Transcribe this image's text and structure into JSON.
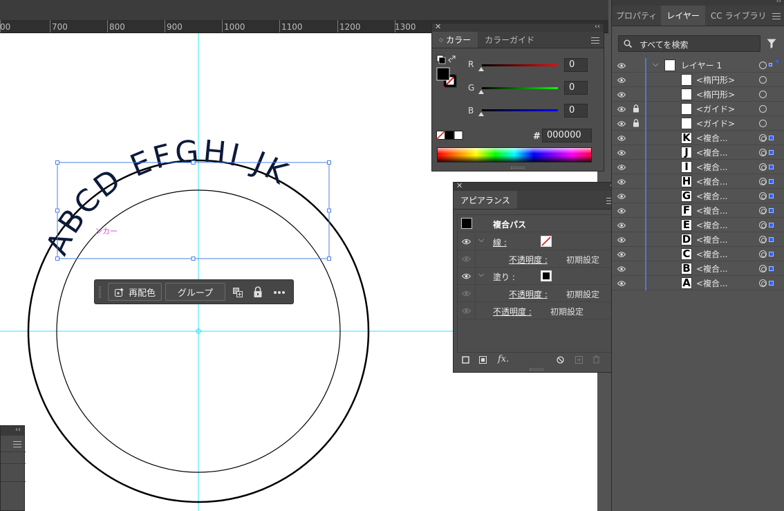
{
  "ruler": {
    "labels": [
      "00",
      "700",
      "800",
      "900",
      "1000",
      "1100",
      "1200",
      "1300"
    ]
  },
  "canvas": {
    "curved_text": "ABCD EFGHI JK",
    "anchor_label": "ンカー"
  },
  "context_toolbar": {
    "recolor_label": "再配色",
    "group_label": "グループ"
  },
  "color_panel": {
    "tabs": [
      "カラー",
      "カラーガイド"
    ],
    "r_label": "R",
    "g_label": "G",
    "b_label": "B",
    "r_value": "0",
    "g_value": "0",
    "b_value": "0",
    "hex_label": "#",
    "hex_value": "000000"
  },
  "appearance_panel": {
    "tab": "アピアランス",
    "title": "複合パス",
    "stroke_label": "線 :",
    "fill_label": "塗り :",
    "opacity_label": "不透明度 :",
    "opacity_value": "初期設定",
    "fx_label": "fx."
  },
  "layers_panel": {
    "tabs": [
      "プロパティ",
      "レイヤー",
      "CC ライブラリ"
    ],
    "search_placeholder": "すべてを検索",
    "layer_name": "レイヤー 1",
    "items": [
      {
        "name": "<楕円形>",
        "thumb": "",
        "locked": false,
        "compound": false
      },
      {
        "name": "<楕円形>",
        "thumb": "",
        "locked": false,
        "compound": false
      },
      {
        "name": "<ガイド>",
        "thumb": "",
        "locked": true,
        "compound": false
      },
      {
        "name": "<ガイド>",
        "thumb": "",
        "locked": true,
        "compound": false
      },
      {
        "name": "<複合...",
        "thumb": "K",
        "locked": false,
        "compound": true
      },
      {
        "name": "<複合...",
        "thumb": "J",
        "locked": false,
        "compound": true
      },
      {
        "name": "<複合...",
        "thumb": "I",
        "locked": false,
        "compound": true
      },
      {
        "name": "<複合...",
        "thumb": "H",
        "locked": false,
        "compound": true
      },
      {
        "name": "<複合...",
        "thumb": "G",
        "locked": false,
        "compound": true
      },
      {
        "name": "<複合...",
        "thumb": "F",
        "locked": false,
        "compound": true
      },
      {
        "name": "<複合...",
        "thumb": "E",
        "locked": false,
        "compound": true
      },
      {
        "name": "<複合...",
        "thumb": "D",
        "locked": false,
        "compound": true
      },
      {
        "name": "<複合...",
        "thumb": "C",
        "locked": false,
        "compound": true
      },
      {
        "name": "<複合...",
        "thumb": "B",
        "locked": false,
        "compound": true
      },
      {
        "name": "<複合...",
        "thumb": "A",
        "locked": false,
        "compound": true
      }
    ]
  },
  "colors": {
    "guide": "#33e0ff",
    "selection": "#4a7fe0",
    "text": "#0d1a3a"
  },
  "icons": [
    "search-icon",
    "filter-icon",
    "eye-icon",
    "lock-icon",
    "chevron-down-icon",
    "menu-icon",
    "close-icon",
    "collapse-icon"
  ]
}
